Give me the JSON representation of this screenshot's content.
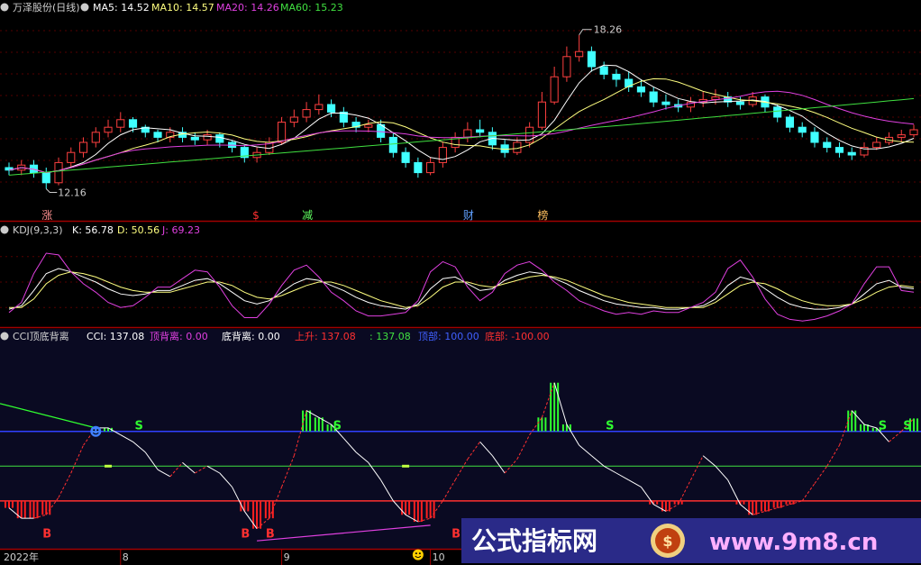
{
  "main_panel": {
    "title": "万泽股份(日线)",
    "ma5_label": "MA5: 14.52",
    "ma10_label": "MA10: 14.57",
    "ma20_label": "MA20: 14.26",
    "ma60_label": "MA60: 15.23",
    "high_label": "18.26",
    "low_label": "12.16",
    "events": [
      {
        "label": "涨",
        "index": 3,
        "color": "#ff9090"
      },
      {
        "label": "$",
        "index": 20,
        "color": "#ff3030"
      },
      {
        "label": "减",
        "index": 24,
        "color": "#60ff60"
      },
      {
        "label": "财",
        "index": 37,
        "color": "#60a0ff"
      },
      {
        "label": "榜",
        "index": 43,
        "color": "#ffc060"
      }
    ]
  },
  "kdj_panel": {
    "title": "KDJ(9,3,3)",
    "k_label": "K: 56.78",
    "d_label": "D: 50.56",
    "j_label": "J: 69.23"
  },
  "cci_panel": {
    "title": "CCI顶底背离",
    "cci_label": "CCI: 137.08",
    "top_div_label": "顶背离: 0.00",
    "bottom_div_label": "底背离: 0.00",
    "rise_label": "上升: 137.08",
    "fall_label": ": 137.08",
    "top_label": "顶部: 100.00",
    "bottom_label": "底部: -100.00",
    "s_label": "S",
    "b_label": "B",
    "smile_icon": "smiley-face-icon"
  },
  "date_axis": {
    "labels": [
      {
        "text": "2022年",
        "index": 0
      },
      {
        "text": "8",
        "index": 9
      },
      {
        "text": "9",
        "index": 22
      },
      {
        "text": "10",
        "index": 34
      }
    ]
  },
  "watermark": {
    "text_cn": "公式指标网",
    "text_url": "www.9m8.cn"
  },
  "chart_data": [
    {
      "type": "candlestick",
      "title": "万泽股份(日线)",
      "ylim": [
        11.5,
        19.0
      ],
      "x": [
        0,
        1,
        2,
        3,
        4,
        5,
        6,
        7,
        8,
        9,
        10,
        11,
        12,
        13,
        14,
        15,
        16,
        17,
        18,
        19,
        20,
        21,
        22,
        23,
        24,
        25,
        26,
        27,
        28,
        29,
        30,
        31,
        32,
        33,
        34,
        35,
        36,
        37,
        38,
        39,
        40,
        41,
        42,
        43,
        44,
        45,
        46,
        47,
        48,
        49,
        50,
        51,
        52,
        53,
        54,
        55,
        56,
        57,
        58,
        59,
        60,
        61,
        62,
        63,
        64,
        65,
        66,
        67,
        68,
        69,
        70,
        71,
        72,
        73
      ],
      "open": [
        13.0,
        12.9,
        13.1,
        12.8,
        12.4,
        13.2,
        13.6,
        14.0,
        14.4,
        14.6,
        14.9,
        14.6,
        14.4,
        14.2,
        14.4,
        14.2,
        14.1,
        14.3,
        14.0,
        13.8,
        13.4,
        13.6,
        14.0,
        14.8,
        15.0,
        15.3,
        15.5,
        15.2,
        14.8,
        14.6,
        14.7,
        14.2,
        13.6,
        13.2,
        12.8,
        13.2,
        13.8,
        14.2,
        14.5,
        14.4,
        13.9,
        13.6,
        14.0,
        14.6,
        15.6,
        16.6,
        17.4,
        17.6,
        17.0,
        16.7,
        16.5,
        16.2,
        16.0,
        15.6,
        15.5,
        15.4,
        15.6,
        15.7,
        15.8,
        15.6,
        15.5,
        15.8,
        15.4,
        15.0,
        14.6,
        14.4,
        14.0,
        13.8,
        13.6,
        13.5,
        13.8,
        14.0,
        14.2,
        14.3
      ],
      "close": [
        12.9,
        13.1,
        12.8,
        12.4,
        13.2,
        13.6,
        14.0,
        14.4,
        14.6,
        14.9,
        14.6,
        14.4,
        14.2,
        14.4,
        14.2,
        14.1,
        14.3,
        14.0,
        13.8,
        13.4,
        13.6,
        14.0,
        14.8,
        15.0,
        15.3,
        15.5,
        15.2,
        14.8,
        14.6,
        14.7,
        14.2,
        13.6,
        13.2,
        12.8,
        13.2,
        13.8,
        14.2,
        14.5,
        14.4,
        13.9,
        13.6,
        14.0,
        14.6,
        15.6,
        16.6,
        17.4,
        17.6,
        17.0,
        16.7,
        16.5,
        16.2,
        16.0,
        15.6,
        15.5,
        15.4,
        15.6,
        15.7,
        15.8,
        15.6,
        15.5,
        15.8,
        15.4,
        15.0,
        14.6,
        14.4,
        14.0,
        13.8,
        13.6,
        13.5,
        13.8,
        14.0,
        14.2,
        14.3,
        14.5
      ],
      "high": [
        13.2,
        13.3,
        13.3,
        13.0,
        13.4,
        13.8,
        14.2,
        14.6,
        14.9,
        15.2,
        15.0,
        14.7,
        14.5,
        14.6,
        14.6,
        14.4,
        14.5,
        14.4,
        14.1,
        13.9,
        13.8,
        14.2,
        15.0,
        15.3,
        15.6,
        15.9,
        15.7,
        15.4,
        15.0,
        14.9,
        14.9,
        14.4,
        13.8,
        13.4,
        13.4,
        14.0,
        14.4,
        14.8,
        14.9,
        14.6,
        14.1,
        14.2,
        14.8,
        16.0,
        17.0,
        17.8,
        18.26,
        17.8,
        17.2,
        16.9,
        16.8,
        16.5,
        16.2,
        15.9,
        15.7,
        15.8,
        16.0,
        16.1,
        16.0,
        15.8,
        16.0,
        15.9,
        15.5,
        15.1,
        14.8,
        14.6,
        14.2,
        14.0,
        13.8,
        14.0,
        14.2,
        14.4,
        14.5,
        14.7
      ],
      "low": [
        12.7,
        12.7,
        12.6,
        12.16,
        12.3,
        13.0,
        13.4,
        13.8,
        14.2,
        14.4,
        14.4,
        14.2,
        14.0,
        14.0,
        14.0,
        13.9,
        13.9,
        13.8,
        13.6,
        13.2,
        13.2,
        13.5,
        13.9,
        14.6,
        14.8,
        15.1,
        15.0,
        14.6,
        14.4,
        14.4,
        14.0,
        13.4,
        13.0,
        12.6,
        12.7,
        13.0,
        13.6,
        14.0,
        14.2,
        13.7,
        13.4,
        13.5,
        13.8,
        14.5,
        15.5,
        16.4,
        17.2,
        16.8,
        16.5,
        16.2,
        16.0,
        15.8,
        15.4,
        15.3,
        15.2,
        15.2,
        15.4,
        15.5,
        15.4,
        15.3,
        15.4,
        15.2,
        14.8,
        14.4,
        14.2,
        13.8,
        13.6,
        13.4,
        13.3,
        13.4,
        13.7,
        13.9,
        14.0,
        14.2
      ]
    },
    {
      "type": "line",
      "title": "KDJ(9,3,3)",
      "ylim": [
        0,
        100
      ],
      "series": [
        {
          "name": "K",
          "values": [
            18,
            22,
            40,
            60,
            66,
            62,
            56,
            50,
            42,
            36,
            34,
            36,
            40,
            40,
            46,
            52,
            54,
            48,
            38,
            28,
            24,
            28,
            38,
            48,
            54,
            52,
            46,
            40,
            32,
            26,
            22,
            20,
            18,
            24,
            42,
            54,
            56,
            48,
            40,
            42,
            52,
            58,
            62,
            60,
            54,
            48,
            40,
            34,
            28,
            24,
            22,
            20,
            20,
            18,
            18,
            20,
            22,
            30,
            46,
            56,
            52,
            42,
            32,
            24,
            20,
            18,
            18,
            20,
            24,
            36,
            48,
            52,
            44,
            42
          ]
        },
        {
          "name": "D",
          "values": [
            20,
            20,
            30,
            48,
            58,
            62,
            60,
            56,
            50,
            44,
            40,
            38,
            38,
            38,
            42,
            46,
            50,
            50,
            46,
            38,
            32,
            30,
            34,
            40,
            46,
            50,
            50,
            46,
            40,
            34,
            28,
            24,
            20,
            22,
            32,
            44,
            50,
            50,
            46,
            44,
            48,
            52,
            56,
            58,
            56,
            52,
            46,
            40,
            34,
            30,
            26,
            24,
            22,
            20,
            20,
            20,
            20,
            26,
            36,
            46,
            50,
            48,
            42,
            34,
            28,
            24,
            22,
            22,
            24,
            30,
            38,
            44,
            46,
            44
          ]
        },
        {
          "name": "J",
          "values": [
            14,
            26,
            60,
            84,
            82,
            62,
            48,
            38,
            26,
            20,
            22,
            32,
            44,
            44,
            54,
            64,
            62,
            44,
            22,
            8,
            8,
            24,
            46,
            64,
            70,
            56,
            38,
            28,
            16,
            10,
            10,
            12,
            14,
            28,
            62,
            74,
            68,
            44,
            28,
            38,
            60,
            70,
            74,
            64,
            50,
            40,
            28,
            22,
            16,
            12,
            14,
            12,
            16,
            14,
            14,
            20,
            26,
            38,
            66,
            76,
            56,
            30,
            12,
            6,
            4,
            6,
            10,
            16,
            24,
            48,
            68,
            68,
            40,
            38
          ]
        }
      ]
    },
    {
      "type": "line",
      "title": "CCI顶底背离",
      "ylim": [
        -230,
        330
      ],
      "series": [
        {
          "name": "CCI",
          "values": [
            -120,
            -150,
            -150,
            -140,
            -90,
            -20,
            60,
            110,
            110,
            90,
            70,
            40,
            -10,
            -30,
            10,
            -20,
            0,
            -20,
            -60,
            -130,
            -180,
            -150,
            -60,
            30,
            160,
            140,
            120,
            80,
            40,
            10,
            -40,
            -100,
            -140,
            -160,
            -150,
            -100,
            -40,
            20,
            70,
            30,
            -20,
            20,
            90,
            140,
            240,
            120,
            60,
            30,
            0,
            -20,
            -40,
            -60,
            -110,
            -130,
            -110,
            -40,
            30,
            0,
            -40,
            -110,
            -140,
            -130,
            -120,
            -110,
            -100,
            -50,
            0,
            60,
            160,
            120,
            110,
            70,
            100,
            137.08
          ]
        },
        {
          "name": "顶部",
          "values": [
            100
          ]
        },
        {
          "name": "底部",
          "values": [
            -100
          ]
        }
      ]
    }
  ]
}
